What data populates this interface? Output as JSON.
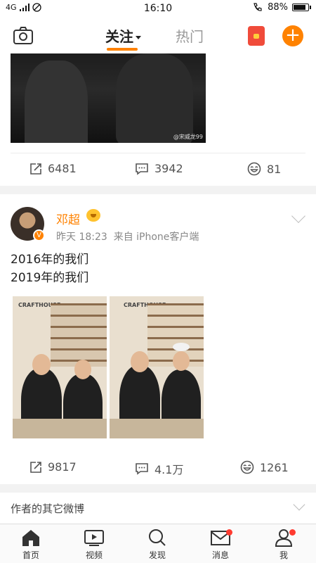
{
  "status_bar": {
    "network": "4G",
    "time": "16:10",
    "battery": "88%",
    "battery_level": 0.88
  },
  "top_nav": {
    "camera_icon": "camera-icon",
    "tab_follow": "关注",
    "tab_hot": "热门",
    "red_packet_icon": "red-packet-icon",
    "compose_icon": "plus-icon",
    "accent": "#ff8200"
  },
  "previous_post": {
    "image_watermark": "@宋威龙99",
    "repost_count": "6481",
    "comment_count": "3942",
    "like_count": "81"
  },
  "post": {
    "username": "邓超",
    "time": "昨天 18:23",
    "source": "来自 iPhone客户端",
    "text_line1": "2016年的我们",
    "text_line2": "2019年的我们",
    "photo1_sign": "CRAFTHOUSE",
    "photo2_sign": "CRAFTHOUSE",
    "repost_count": "9817",
    "comment_count": "4.1万",
    "like_count": "1261"
  },
  "other_posts": {
    "label": "作者的其它微博"
  },
  "bottom_nav": {
    "home": "首页",
    "video": "视频",
    "discover": "发现",
    "messages": "消息",
    "me": "我"
  }
}
